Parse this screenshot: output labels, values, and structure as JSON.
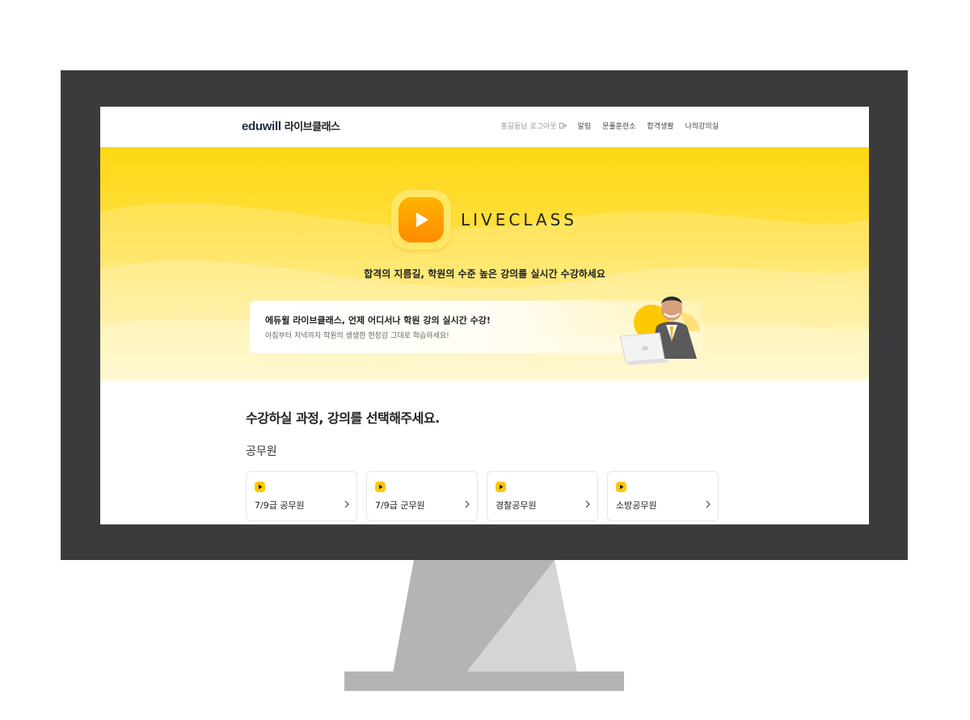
{
  "header": {
    "logo_en": "eduwill",
    "logo_ko": "라이브클래스",
    "user_text": "홍길동님 로그아웃",
    "nav": [
      "알림",
      "문풀훈련소",
      "합격생활",
      "나의강의실"
    ]
  },
  "hero": {
    "brand": "LIVECLASS",
    "tagline": "합격의 지름길, 학원의 수준 높은 강의를 실시간 수강하세요",
    "promo_title": "에듀윌 라이브클래스, 언제 어디서나 학원 강의 실시간 수강!",
    "promo_subtitle": "아침부터 저녁까지 학원의 생생한 현장감 그대로 학습하세요!"
  },
  "main": {
    "title": "수강하실 과정, 강의를 선택해주세요.",
    "category": "공무원",
    "courses": [
      "7/9급 공무원",
      "7/9급 군무원",
      "경찰공무원",
      "소방공무원"
    ]
  },
  "colors": {
    "accent": "#ffd813",
    "play": "#ff9b00",
    "bezel": "#3b3b3d"
  }
}
